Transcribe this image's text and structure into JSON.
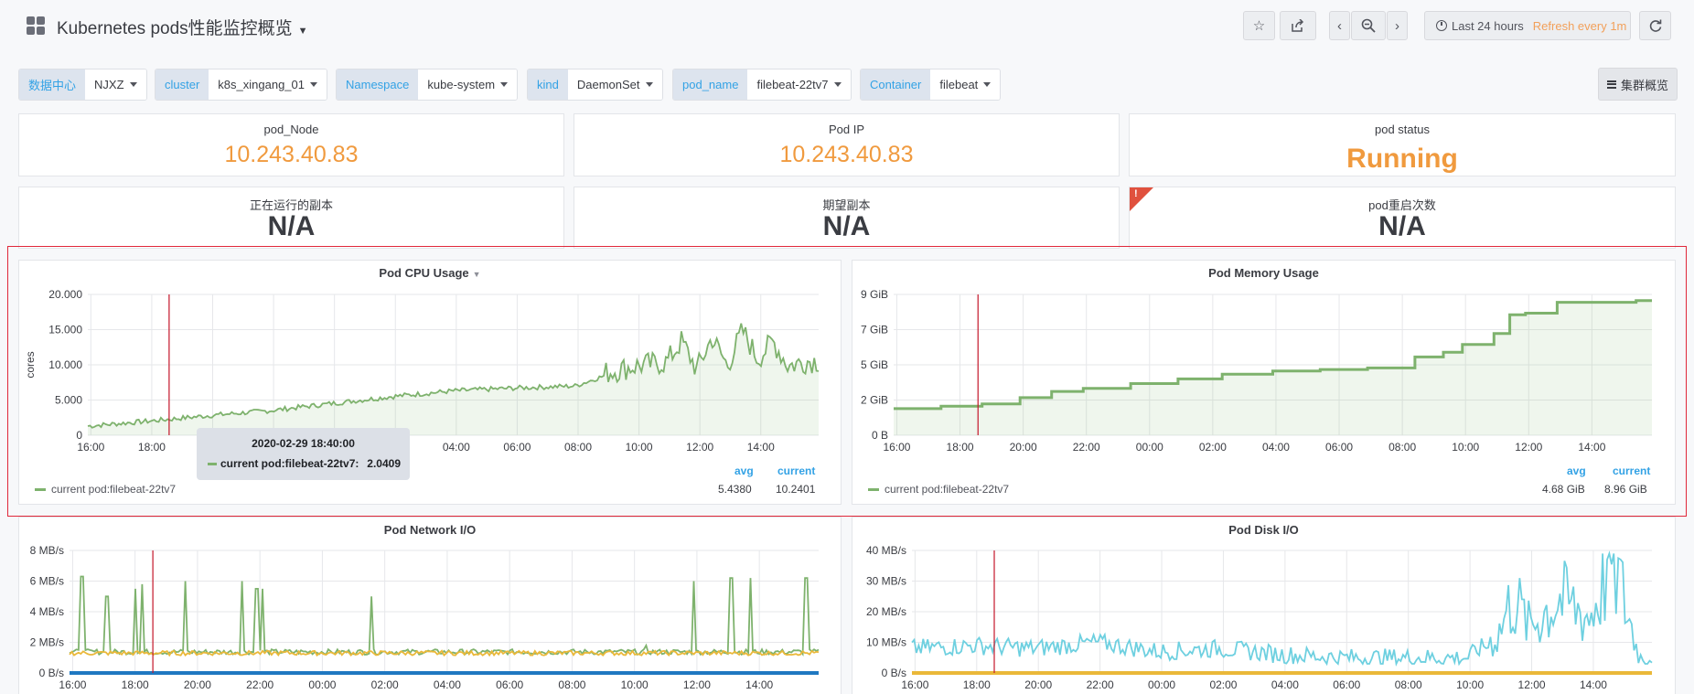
{
  "header": {
    "title": "Kubernetes pods性能监控概览",
    "time_range": "Last 24 hours",
    "refresh": "Refresh every 1m"
  },
  "variables": [
    {
      "label": "数据中心",
      "value": "NJXZ"
    },
    {
      "label": "cluster",
      "value": "k8s_xingang_01"
    },
    {
      "label": "Namespace",
      "value": "kube-system"
    },
    {
      "label": "kind",
      "value": "DaemonSet"
    },
    {
      "label": "pod_name",
      "value": "filebeat-22tv7"
    },
    {
      "label": "Container",
      "value": "filebeat"
    }
  ],
  "cluster_link": "集群概览",
  "stats": {
    "pod_node": {
      "title": "pod_Node",
      "value": "10.243.40.83"
    },
    "pod_ip": {
      "title": "Pod IP",
      "value": "10.243.40.83"
    },
    "pod_status": {
      "title": "pod status",
      "value": "Running"
    },
    "running_replicas": {
      "title": "正在运行的副本",
      "value": "N/A"
    },
    "desired_replicas": {
      "title": "期望副本",
      "value": "N/A"
    },
    "restart_count": {
      "title": "pod重启次数",
      "value": "N/A",
      "alert_mark": "!"
    }
  },
  "cpu_panel": {
    "title": "Pod CPU Usage",
    "legend": {
      "name": "current pod:filebeat-22tv7",
      "avg_label": "avg",
      "current_label": "current",
      "avg": "5.4380",
      "current": "10.2401"
    },
    "tooltip": {
      "time": "2020-02-29 18:40:00",
      "series": "current pod:filebeat-22tv7:",
      "value": "2.0409"
    }
  },
  "memory_panel": {
    "title": "Pod Memory Usage",
    "legend": {
      "name": "current pod:filebeat-22tv7",
      "avg_label": "avg",
      "current_label": "current",
      "avg": "4.68 GiB",
      "current": "8.96 GiB"
    }
  },
  "network_panel": {
    "title": "Pod Network I/O"
  },
  "disk_panel": {
    "title": "Pod Disk I/O"
  },
  "colors": {
    "green": "#7eb26d",
    "yellow": "#eab839",
    "blue": "#1f78c1",
    "cyan": "#6ed0e0",
    "orange_value": "#f09a3e",
    "marker_red": "#c4162a",
    "highlight_red": "#e0283a"
  },
  "chart_data": [
    {
      "type": "line",
      "title": "Pod CPU Usage",
      "ylabel": "cores",
      "x_ticks": [
        "16:00",
        "18:00",
        "20:00",
        "22:00",
        "00:00",
        "02:00",
        "04:00",
        "06:00",
        "08:00",
        "10:00",
        "12:00",
        "14:00"
      ],
      "y_ticks": [
        "0",
        "5.000",
        "10.000",
        "15.000",
        "20.000"
      ],
      "ylim": [
        0,
        20
      ],
      "series": [
        {
          "name": "current pod:filebeat-22tv7",
          "x": [
            0,
            2,
            4,
            6,
            8,
            10,
            12,
            14,
            16,
            17,
            18,
            19,
            19.5,
            20,
            20.5,
            21,
            21.5,
            22,
            22.5,
            23,
            23.6
          ],
          "values": [
            1.3,
            2.0,
            2.8,
            3.5,
            4.5,
            5.5,
            6.3,
            6.7,
            7.0,
            8.5,
            9.5,
            10.0,
            13.0,
            9.0,
            13.5,
            9.5,
            14.5,
            10.5,
            13.0,
            9.5,
            10.2
          ]
        }
      ],
      "area": true,
      "marker_x": 2.67
    },
    {
      "type": "line",
      "title": "Pod Memory Usage",
      "y_ticks": [
        "0 B",
        "2 GiB",
        "5 GiB",
        "7 GiB",
        "9 GiB"
      ],
      "x_ticks": [
        "16:00",
        "18:00",
        "20:00",
        "22:00",
        "00:00",
        "02:00",
        "04:00",
        "06:00",
        "08:00",
        "10:00",
        "12:00",
        "14:00"
      ],
      "ylim": [
        0,
        9
      ],
      "series": [
        {
          "name": "current pod:filebeat-22tv7",
          "x": [
            0,
            1.5,
            2.8,
            4,
            5,
            6,
            7.5,
            9,
            10.4,
            12,
            13.5,
            15,
            16.5,
            17.4,
            18,
            19,
            19.5,
            20,
            21,
            23.5
          ],
          "values": [
            1.7,
            1.85,
            2.0,
            2.4,
            2.8,
            3.0,
            3.3,
            3.6,
            3.9,
            4.1,
            4.2,
            4.3,
            5.0,
            5.3,
            5.8,
            6.5,
            7.7,
            7.8,
            8.5,
            8.6
          ]
        }
      ],
      "area": true,
      "marker_x": 2.67
    },
    {
      "type": "line",
      "title": "Pod Network I/O",
      "y_ticks": [
        "0 B/s",
        "2 MB/s",
        "4 MB/s",
        "6 MB/s",
        "8 MB/s"
      ],
      "x_ticks": [
        "16:00",
        "18:00",
        "20:00",
        "22:00",
        "00:00",
        "02:00",
        "04:00",
        "06:00",
        "08:00",
        "10:00",
        "12:00",
        "14:00"
      ],
      "ylim": [
        0,
        8
      ],
      "series": [
        {
          "x": [
            0.4,
            1.2,
            2.1,
            2.3,
            3.7,
            5.5,
            6.0,
            6.2,
            9.7,
            18.5,
            20.0,
            21.2,
            21.8,
            23.6
          ],
          "values": [
            6.3,
            5.0,
            5.5,
            5.8,
            6.0,
            6.0,
            5.5,
            5.5,
            5.0,
            1.8,
            6.0,
            6.2,
            6.2,
            6.2
          ]
        },
        {
          "x": [
            0,
            24
          ],
          "values": [
            1.3,
            1.3
          ]
        },
        {
          "x": [
            0,
            24
          ],
          "values": [
            0,
            0
          ]
        }
      ],
      "marker_x": 2.67
    },
    {
      "type": "line",
      "title": "Pod Disk I/O",
      "y_ticks": [
        "0 B/s",
        "10 MB/s",
        "20 MB/s",
        "30 MB/s",
        "40 MB/s"
      ],
      "x_ticks": [
        "16:00",
        "18:00",
        "20:00",
        "22:00",
        "00:00",
        "02:00",
        "04:00",
        "06:00",
        "08:00",
        "10:00",
        "12:00",
        "14:00"
      ],
      "ylim": [
        0,
        40
      ],
      "series": [
        {
          "x": [
            0,
            2,
            4,
            6,
            8,
            10,
            12,
            14,
            16,
            18,
            19,
            19.5,
            20,
            21,
            22,
            22.7,
            23.6
          ],
          "values": [
            8,
            9,
            8,
            10,
            7,
            8,
            6,
            5,
            5,
            5,
            12,
            25,
            15,
            24,
            18,
            38,
            5
          ]
        },
        {
          "x": [
            0,
            24
          ],
          "values": [
            0,
            0
          ]
        }
      ],
      "marker_x": 2.67
    }
  ]
}
